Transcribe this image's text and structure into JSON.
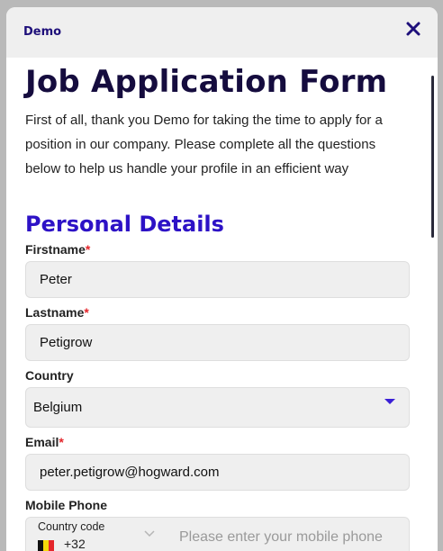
{
  "modal": {
    "title": "Demo",
    "close_icon": "close-icon"
  },
  "form": {
    "heading": "Job Application Form",
    "intro": "First of all, thank you Demo for taking the time to apply for a position in our company. Please complete all the questions below to help us handle your profile in an efficient way",
    "section_title": "Personal Details",
    "required_mark": "*",
    "firstname": {
      "label": "Firstname",
      "value": "Peter"
    },
    "lastname": {
      "label": "Lastname",
      "value": "Petigrow"
    },
    "country": {
      "label": "Country",
      "value": "Belgium"
    },
    "email": {
      "label": "Email",
      "value": "peter.petigrow@hogward.com"
    },
    "mobile": {
      "label": "Mobile Phone",
      "country_code_label": "Country code",
      "country_code_value": "+32",
      "flag_icon": "belgium-flag-icon",
      "placeholder": "Please enter your mobile phone"
    }
  },
  "colors": {
    "heading": "#150c3e",
    "section": "#2d12c6",
    "accent": "#3a1fd6",
    "required": "#e4262b"
  }
}
